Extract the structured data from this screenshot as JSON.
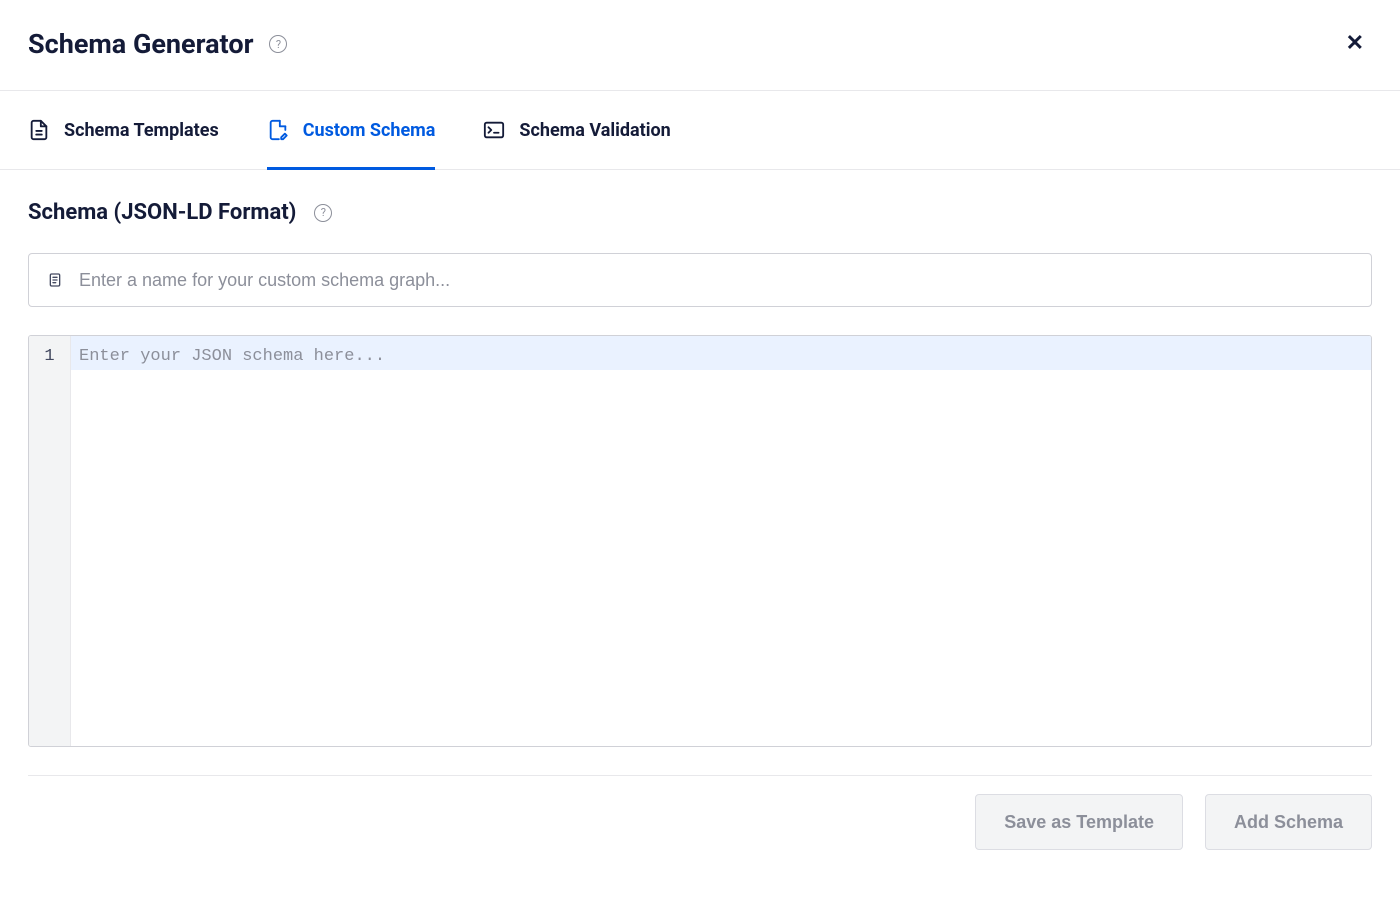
{
  "header": {
    "title": "Schema Generator"
  },
  "tabs": [
    {
      "label": "Schema Templates",
      "icon": "file-icon",
      "active": false
    },
    {
      "label": "Custom Schema",
      "icon": "file-edit-icon",
      "active": true
    },
    {
      "label": "Schema Validation",
      "icon": "terminal-icon",
      "active": false
    }
  ],
  "section": {
    "title": "Schema (JSON-LD Format)"
  },
  "name_input": {
    "value": "",
    "placeholder": "Enter a name for your custom schema graph..."
  },
  "editor": {
    "line_numbers": [
      "1"
    ],
    "value": "",
    "placeholder": "Enter your JSON schema here..."
  },
  "footer": {
    "save_template_label": "Save as Template",
    "add_schema_label": "Add Schema"
  },
  "colors": {
    "accent": "#005ae0",
    "text": "#141b38",
    "muted": "#8c8f9a",
    "border": "#d0d1d7"
  }
}
